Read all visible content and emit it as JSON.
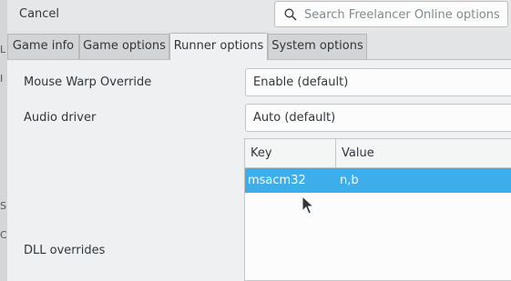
{
  "background": {
    "glyphs": [
      "L",
      "I",
      "S",
      "C"
    ]
  },
  "header": {
    "cancel_label": "Cancel",
    "search_placeholder": "Search Freelancer Online options"
  },
  "tabs": [
    {
      "label": "Game info",
      "active": false
    },
    {
      "label": "Game options",
      "active": false
    },
    {
      "label": "Runner options",
      "active": true
    },
    {
      "label": "System options",
      "active": false
    }
  ],
  "settings": {
    "mouse_warp": {
      "label": "Mouse Warp Override",
      "value": "Enable (default)"
    },
    "audio_driver": {
      "label": "Audio driver",
      "value": "Auto (default)"
    },
    "dll_overrides": {
      "label": "DLL overrides",
      "columns": {
        "key": "Key",
        "value": "Value"
      },
      "rows": [
        {
          "key": "msacm32",
          "value": "n,b"
        }
      ]
    }
  },
  "colors": {
    "selection": "#3daee9",
    "background": "#eff0f1"
  }
}
